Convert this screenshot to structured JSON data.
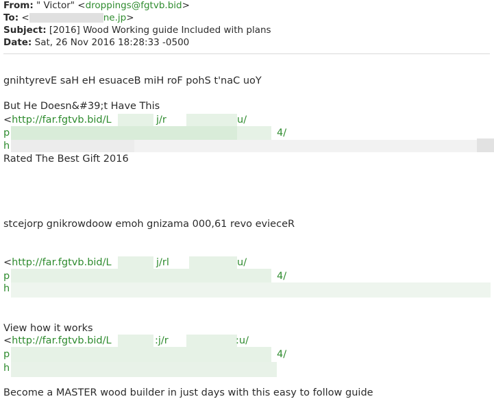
{
  "headers": {
    "from_label": "From:",
    "from_name": " \" Victor\" <",
    "from_email": "droppings@fgtvb.bid",
    "from_close": ">",
    "to_label": "To:",
    "to_open": " <",
    "to_email_suffix": "ne.jp",
    "to_close": ">",
    "subject_label": "Subject:",
    "subject_value": " [2016] Wood Working guide Included with plans",
    "date_label": "Date:",
    "date_value": " Sat, 26 Nov 2016 18:28:33 -0500"
  },
  "body": {
    "line1": "gnihtyrevE saH eH esuaceB miH roF pohS t'naC uoY",
    "line2": "But He Doesn&#39;t Have This",
    "link1_prefix": "<",
    "link1_a": "http://far.fgtvb.bid/L",
    "link1_b": "j/r",
    "link1_c": "u/",
    "link1_p": "p",
    "link1_4": "4/",
    "link1_h": "h",
    "line3": "Rated The Best Gift 2016",
    "line4": "stcejorp gnikrowdoow emoh gnizama 000,61 revo evieceR",
    "link2_prefix": "<",
    "link2_a": "http://far.fgtvb.bid/L",
    "link2_b": "j/rl",
    "link2_c": "u/",
    "link2_p": "p",
    "link2_4": "4/",
    "link2_h": "h",
    "line5": "View how it works",
    "link3_prefix": "<",
    "link3_a": "http://far.fgtvb.bid/L",
    "link3_b": ":j/r",
    "link3_c": ":u/",
    "link3_p": "p",
    "link3_4": "4/",
    "link3_h": "h",
    "line6": "Become a MASTER wood builder in just days with this easy to follow guide"
  },
  "colors": {
    "link": "#2e8b2e",
    "redaction": "#d9ecd9",
    "text": "#2b2b2b"
  }
}
